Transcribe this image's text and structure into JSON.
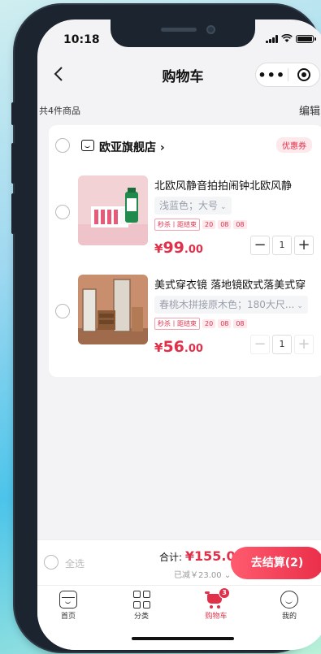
{
  "status_bar": {
    "time": "10:18"
  },
  "nav": {
    "back_icon": "chevron-left-icon",
    "title": "购物车",
    "more_label": "•••"
  },
  "summary": {
    "count_text": "共4件商品",
    "edit_label": "编辑"
  },
  "shop": {
    "name": "欧亚旗舰店 ›",
    "coupon_label": "优惠券"
  },
  "items": [
    {
      "title": "北欧风静音拍拍闹钟北欧风静",
      "spec": "浅蓝色；大号",
      "flash_tag": "秒杀丨距结束",
      "countdown": [
        "20",
        "08",
        "08"
      ],
      "price_symbol": "¥",
      "price_int": "99",
      "price_dec": ".00",
      "quantity": "1",
      "minus_disabled": false
    },
    {
      "title": "美式穿衣镜 落地镜欧式落美式穿",
      "spec": "春桃木拼接原木色；180大尺...",
      "flash_tag": "秒杀丨距结束",
      "countdown": [
        "20",
        "08",
        "08"
      ],
      "price_symbol": "¥",
      "price_int": "56",
      "price_dec": ".00",
      "quantity": "1",
      "minus_disabled": true
    }
  ],
  "footer": {
    "select_all": "全选",
    "total_label": "合计:",
    "total_amount": "¥155.00",
    "saved": "已减￥23.00",
    "checkout": "去结算(2)"
  },
  "tabbar": {
    "tabs": [
      {
        "label": "首页",
        "icon": "home-icon"
      },
      {
        "label": "分类",
        "icon": "category-grid-icon"
      },
      {
        "label": "购物车",
        "icon": "cart-icon",
        "badge": "3",
        "active": true
      },
      {
        "label": "我的",
        "icon": "profile-icon"
      }
    ]
  },
  "colors": {
    "accent": "#e0304a",
    "accent_light": "#fde8ec",
    "page_bg": "#f3f3f5"
  }
}
